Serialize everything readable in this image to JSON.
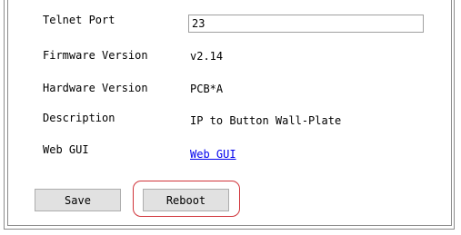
{
  "form": {
    "telnet_port_label": "Telnet Port",
    "telnet_port_value": "23",
    "firmware_version_label": "Firmware Version",
    "firmware_version_value": "v2.14",
    "hardware_version_label": "Hardware Version",
    "hardware_version_value": "PCB*A",
    "description_label": "Description",
    "description_value": "IP to Button Wall-Plate",
    "web_gui_label": "Web GUI",
    "web_gui_link": "Web GUI"
  },
  "buttons": {
    "save_label": "Save",
    "reboot_label": "Reboot"
  },
  "colors": {
    "highlight": "#d0343a",
    "link": "#0000ee"
  }
}
